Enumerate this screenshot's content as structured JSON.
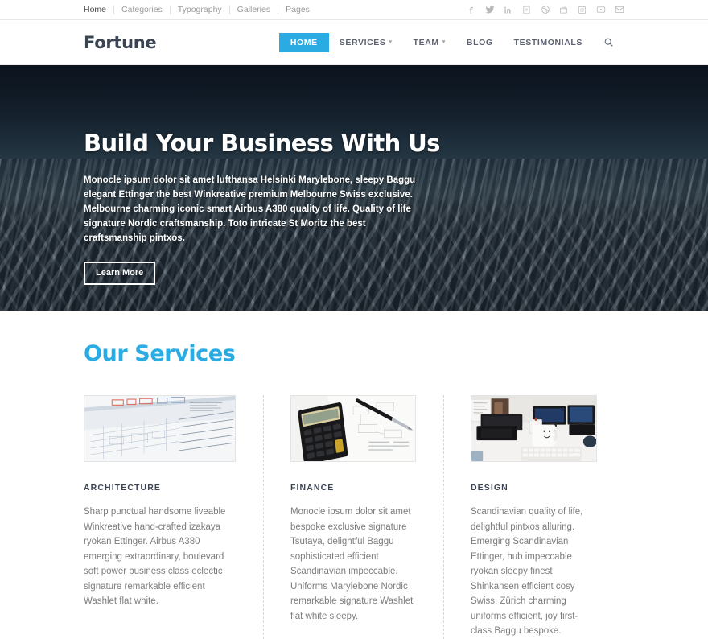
{
  "topbar": {
    "nav": [
      {
        "label": "Home"
      },
      {
        "label": "Categories"
      },
      {
        "label": "Typography"
      },
      {
        "label": "Galleries"
      },
      {
        "label": "Pages"
      }
    ],
    "social": [
      {
        "name": "facebook-icon"
      },
      {
        "name": "twitter-icon"
      },
      {
        "name": "linkedin-icon"
      },
      {
        "name": "vimeo-icon"
      },
      {
        "name": "dribbble-icon"
      },
      {
        "name": "tumblr-icon"
      },
      {
        "name": "instagram-icon"
      },
      {
        "name": "youtube-icon"
      },
      {
        "name": "email-icon"
      }
    ]
  },
  "header": {
    "logo": "Fortune",
    "nav": [
      {
        "label": "HOME",
        "active": true,
        "dropdown": false
      },
      {
        "label": "SERVICES",
        "active": false,
        "dropdown": true
      },
      {
        "label": "TEAM",
        "active": false,
        "dropdown": true
      },
      {
        "label": "BLOG",
        "active": false,
        "dropdown": false
      },
      {
        "label": "TESTIMONIALS",
        "active": false,
        "dropdown": false
      }
    ],
    "search_icon": "search-icon",
    "accent_color": "#2aabe2",
    "logo_color": "#3b4453"
  },
  "hero": {
    "title": "Build Your Business With Us",
    "paragraph": "Monocle ipsum dolor sit amet lufthansa Helsinki Marylebone, sleepy Baggu elegant Ettinger the best Winkreative premium Melbourne Swiss exclusive. Melbourne charming iconic smart Airbus A380 quality of life. Quality of life signature Nordic craftsmanship. Toto intricate St Moritz the best craftsmanship pintxos.",
    "button": "Learn More",
    "background_description": "aerial-mountain-range-photo"
  },
  "services": {
    "title": "Our Services",
    "title_color": "#2aabe2",
    "items": [
      {
        "image": "blueprint-drawings-image",
        "heading": "ARCHITECTURE",
        "body": "Sharp punctual handsome liveable Winkreative hand-crafted izakaya ryokan Ettinger. Airbus A380 emerging extraordinary, boulevard soft power business class eclectic signature remarkable efficient Washlet flat white."
      },
      {
        "image": "calculator-documents-image",
        "heading": "FINANCE",
        "body": "Monocle ipsum dolor sit amet bespoke exclusive signature Tsutaya, delightful Baggu sophisticated efficient Scandinavian impeccable. Uniforms Marylebone Nordic remarkable signature Washlet flat white sleepy."
      },
      {
        "image": "desk-monitors-mug-image",
        "heading": "DESIGN",
        "body": "Scandinavian quality of life, delightful pintxos alluring. Emerging Scandinavian Ettinger, hub impeccable ryokan sleepy finest Shinkansen efficient cosy Swiss. Zürich charming uniforms efficient, joy first-class Baggu bespoke."
      }
    ]
  }
}
